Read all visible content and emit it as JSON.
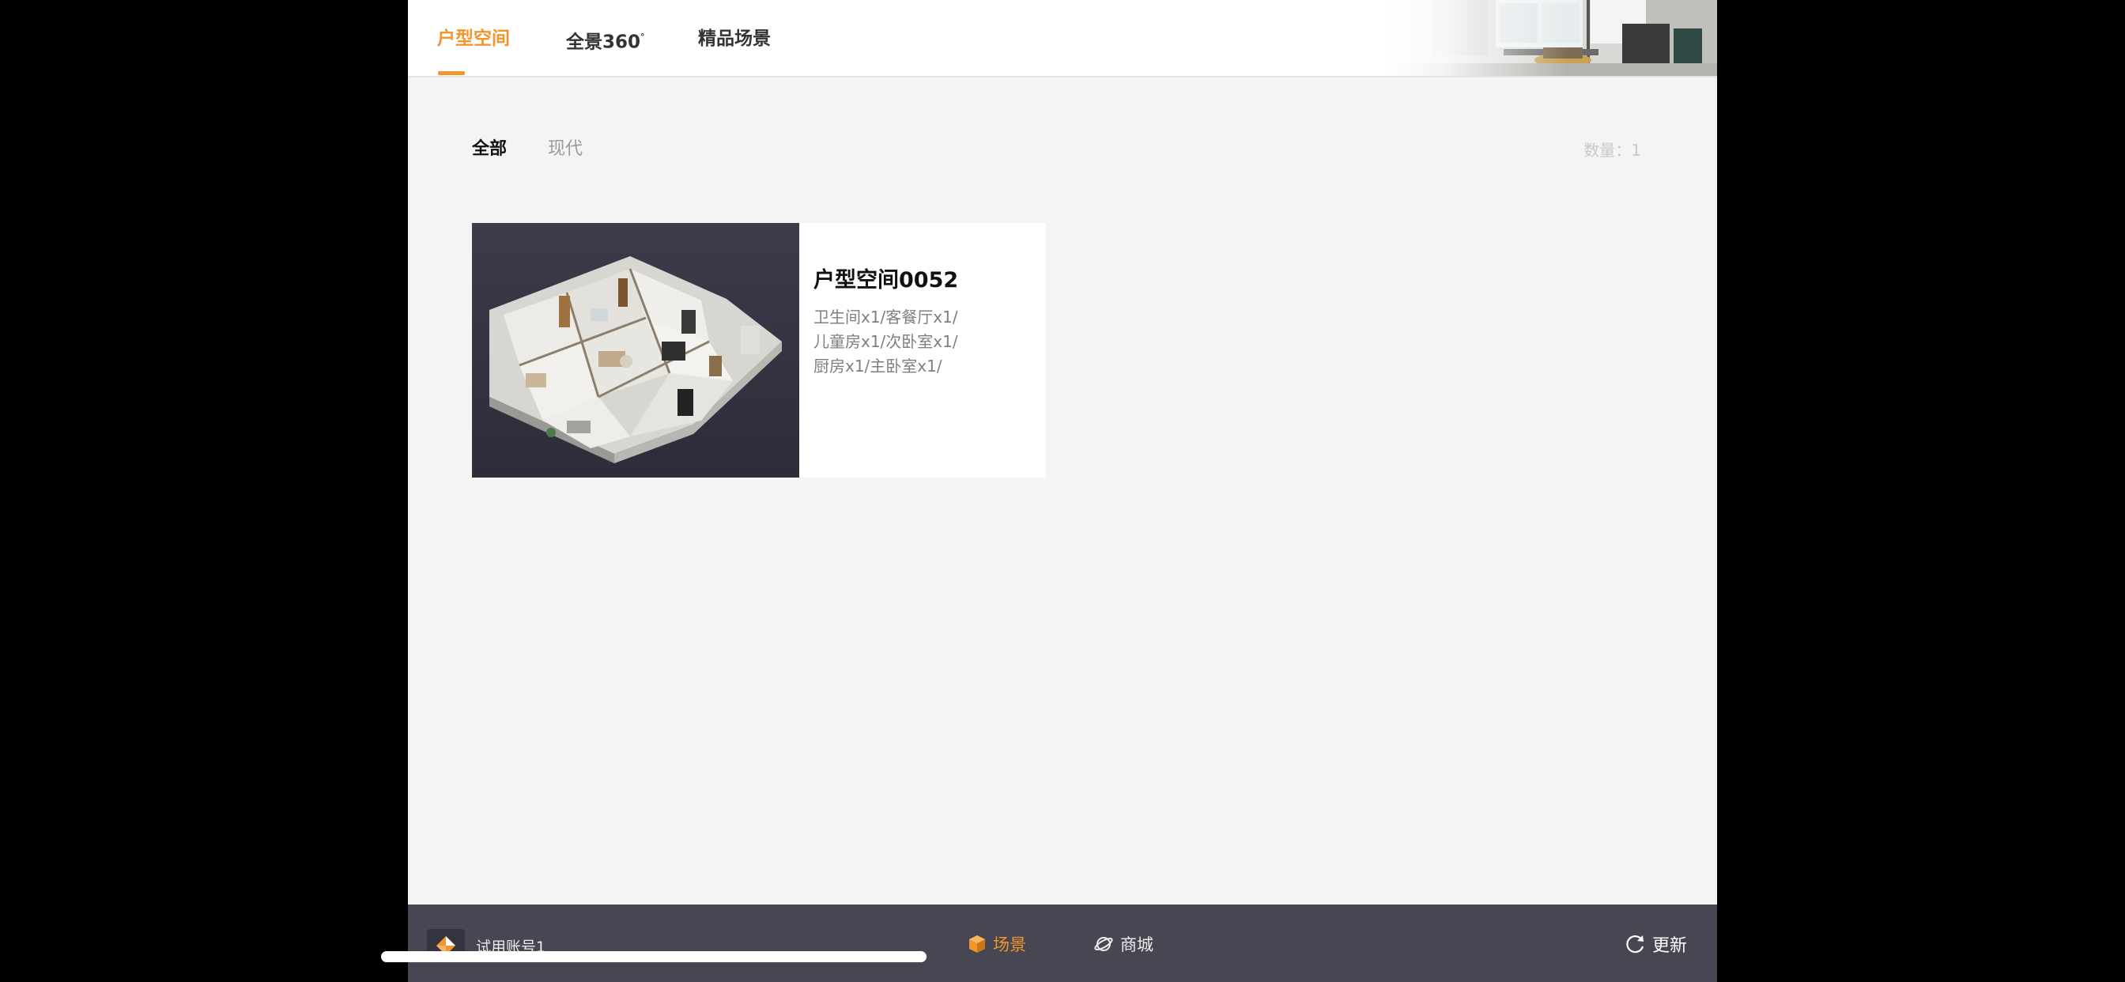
{
  "top_tabs": [
    {
      "label": "户型空间"
    },
    {
      "label": "全景360",
      "suffix": "°"
    },
    {
      "label": "精品场景"
    }
  ],
  "filters": [
    {
      "label": "全部"
    },
    {
      "label": "现代"
    }
  ],
  "count": {
    "label": "数量：",
    "value": "1"
  },
  "card": {
    "title": "户型空间0052",
    "desc_lines": [
      "卫生间x1/客餐厅x1/",
      "儿童房x1/次卧室x1/",
      "厨房x1/主卧室x1/"
    ]
  },
  "bottom": {
    "account_name": "试用账号1",
    "nav": [
      {
        "label": "场景",
        "icon": "cube-icon"
      },
      {
        "label": "商城",
        "icon": "planet-icon"
      }
    ],
    "update_label": "更新"
  },
  "colors": {
    "accent": "#f0962b",
    "bottom_bar": "#474653",
    "background": "#f4f4f4"
  }
}
